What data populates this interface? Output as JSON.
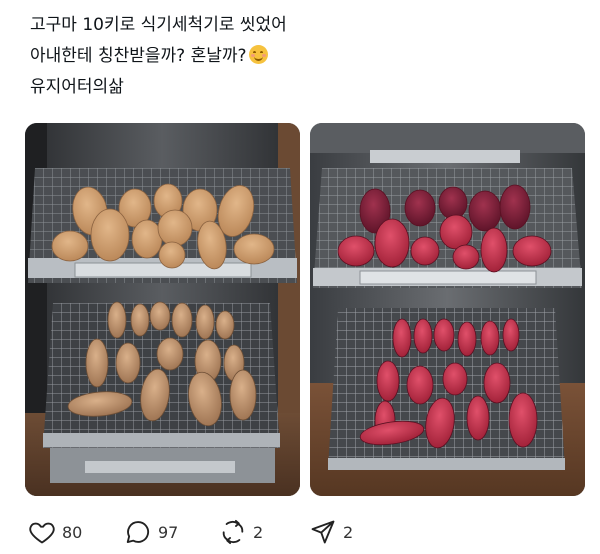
{
  "post": {
    "lines": [
      "고구마 10키로 식기세척기로 씻었어",
      "아내한테 칭찬받을까? 혼날까?",
      "유지어터의삶"
    ],
    "emoji_icon": "smiling-face-emoji"
  },
  "photos": {
    "left_alt_subject": "sweet-potatoes-before-washing",
    "right_alt_subject": "sweet-potatoes-after-washing"
  },
  "actions": {
    "like_count": "80",
    "reply_count": "97",
    "repost_count": "2",
    "share_count": "2",
    "icons": [
      "heart-icon",
      "reply-bubble-icon",
      "repost-icon",
      "share-send-icon"
    ]
  },
  "colors": {
    "text": "#0f1419",
    "potato_raw": "#c9996a",
    "potato_washed": "#b8324a",
    "rack": "#9aa0a6"
  }
}
